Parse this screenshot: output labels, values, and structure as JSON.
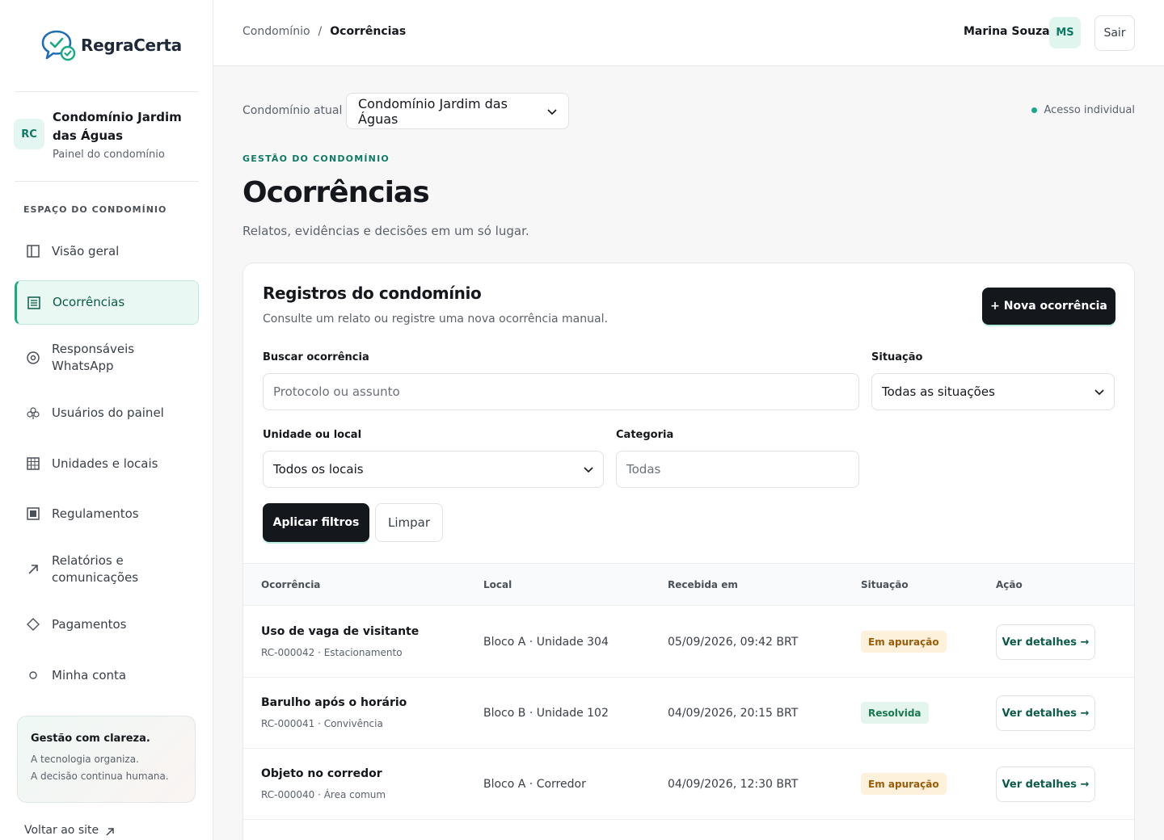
{
  "brand": {
    "name": "RegraCerta"
  },
  "sidebar": {
    "condo": {
      "initials": "RC",
      "name": "Condomínio Jardim das Águas",
      "subtitle": "Painel do condomínio"
    },
    "section_label": "ESPAÇO DO CONDOMÍNIO",
    "items": [
      {
        "label": "Visão geral",
        "icon": "layout-icon"
      },
      {
        "label": "Ocorrências",
        "icon": "list-icon",
        "active": true
      },
      {
        "label": "Responsáveis WhatsApp",
        "icon": "target-icon"
      },
      {
        "label": "Usuários do painel",
        "icon": "users-icon"
      },
      {
        "label": "Unidades e locais",
        "icon": "grid-icon"
      },
      {
        "label": "Regulamentos",
        "icon": "document-icon"
      },
      {
        "label": "Relatórios e comunicações",
        "icon": "arrow-up-right-icon"
      },
      {
        "label": "Pagamentos",
        "icon": "diamond-icon"
      },
      {
        "label": "Minha conta",
        "icon": "circle-icon"
      }
    ],
    "promo": {
      "title": "Gestão com clareza.",
      "line1": "A tecnologia organiza.",
      "line2": "A decisão continua humana."
    },
    "back_link": "Voltar ao site"
  },
  "topbar": {
    "breadcrumb": [
      "Condomínio",
      "/",
      "Ocorrências"
    ],
    "user_name": "Marina Souza",
    "user_initials": "MS",
    "logout_label": "Sair"
  },
  "main": {
    "condo_label": "Condomínio atual",
    "condo_selected": "Condomínio Jardim das Águas",
    "access_label": "Acesso individual",
    "eyebrow": "GESTÃO DO CONDOMÍNIO",
    "title": "Ocorrências",
    "lead": "Relatos, evidências e decisões em um só lugar."
  },
  "card": {
    "title": "Registros do condomínio",
    "subtitle": "Consulte um relato ou registre uma nova ocorrência manual.",
    "new_button": "+ Nova ocorrência",
    "filters": {
      "search_label": "Buscar ocorrência",
      "search_placeholder": "Protocolo ou assunto",
      "status_label": "Situação",
      "status_value": "Todas as situações",
      "unit_label": "Unidade ou local",
      "unit_value": "Todos os locais",
      "category_label": "Categoria",
      "category_placeholder": "Todas",
      "apply_label": "Aplicar filtros",
      "clear_label": "Limpar"
    },
    "table": {
      "headers": [
        "Ocorrência",
        "Local",
        "Recebida em",
        "Situação",
        "Ação"
      ],
      "rows": [
        {
          "title": "Uso de vaga de visitante",
          "meta": "RC-000042 · Estacionamento",
          "local": "Bloco A · Unidade 304",
          "received": "05/09/2026, 09:42 BRT",
          "status": "Em apuração",
          "status_kind": "warn",
          "action": "Ver detalhes →"
        },
        {
          "title": "Barulho após o horário",
          "meta": "RC-000041 · Convivência",
          "local": "Bloco B · Unidade 102",
          "received": "04/09/2026, 20:15 BRT",
          "status": "Resolvida",
          "status_kind": "ok",
          "action": "Ver detalhes →"
        },
        {
          "title": "Objeto no corredor",
          "meta": "RC-000040 · Área comum",
          "local": "Bloco A · Corredor",
          "received": "04/09/2026, 12:30 BRT",
          "status": "Em apuração",
          "status_kind": "warn",
          "action": "Ver detalhes →"
        }
      ]
    }
  },
  "colors": {
    "accent": "#1aa886",
    "dark": "#14171c",
    "warn_bg": "#fdf1dc",
    "ok_bg": "#e3f5ec"
  }
}
